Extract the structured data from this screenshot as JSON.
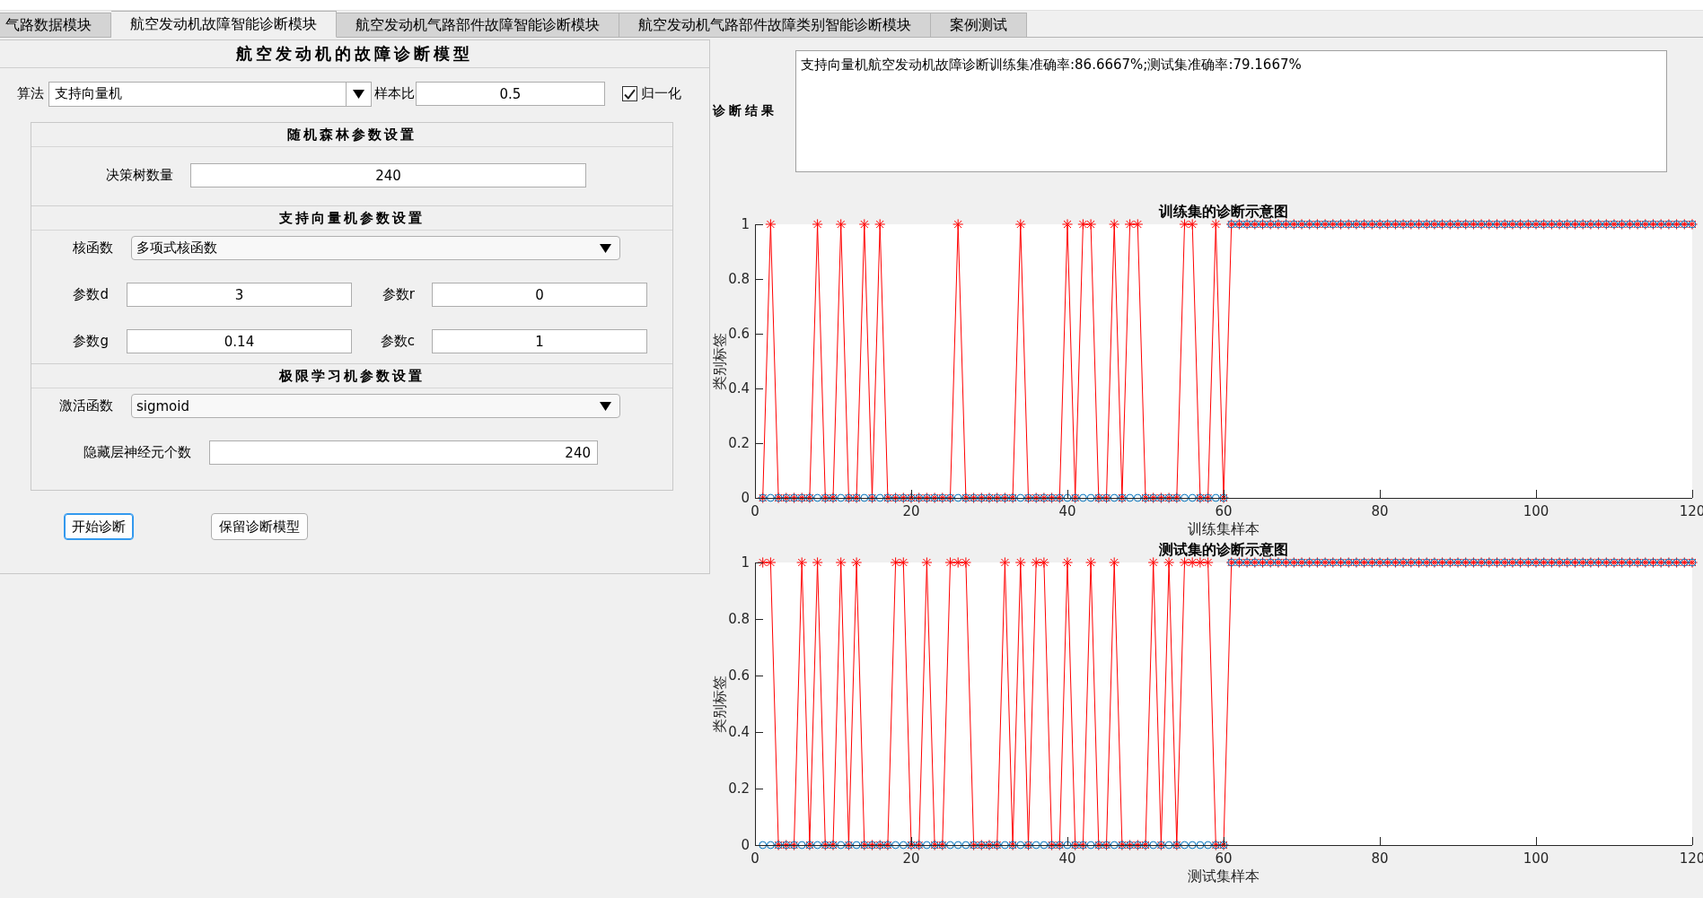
{
  "tabs": [
    {
      "label": "气路数据模块",
      "selected": false
    },
    {
      "label": "航空发动机故障智能诊断模块",
      "selected": true
    },
    {
      "label": "航空发动机气路部件故障智能诊断模块",
      "selected": false
    },
    {
      "label": "航空发动机气路部件故障类别智能诊断模块",
      "selected": false
    },
    {
      "label": "案例测试",
      "selected": false
    }
  ],
  "model_panel": {
    "title": "航空发动机的故障诊断模型",
    "algorithm": {
      "label": "算法",
      "value": "支持向量机"
    },
    "sample_ratio": {
      "label": "样本比",
      "value": "0.5"
    },
    "normalize": {
      "label": "归一化",
      "checked": true
    },
    "sections": [
      {
        "title": "随机森林参数设置",
        "rows": [
          {
            "fields": [
              {
                "kind": "input",
                "label": "决策树数量",
                "value": "240"
              }
            ]
          }
        ]
      },
      {
        "title": "支持向量机参数设置",
        "rows": [
          {
            "fields": [
              {
                "kind": "select",
                "label": "核函数",
                "value": "多项式核函数"
              }
            ]
          },
          {
            "fields": [
              {
                "kind": "input",
                "label": "参数d",
                "value": "3"
              },
              {
                "kind": "input",
                "label": "参数r",
                "value": "0"
              }
            ]
          },
          {
            "fields": [
              {
                "kind": "input",
                "label": "参数g",
                "value": "0.14"
              },
              {
                "kind": "input",
                "label": "参数c",
                "value": "1"
              }
            ]
          }
        ]
      },
      {
        "title": "极限学习机参数设置",
        "rows": [
          {
            "fields": [
              {
                "kind": "select",
                "label": "激活函数",
                "value": "sigmoid"
              }
            ]
          },
          {
            "fields": [
              {
                "kind": "input",
                "label": "隐藏层神经元个数",
                "value": "240"
              }
            ]
          }
        ]
      }
    ],
    "buttons": [
      {
        "label": "开始诊断",
        "focused": true
      },
      {
        "label": "保留诊断模型",
        "focused": false
      }
    ]
  },
  "result": {
    "label": "诊断结果",
    "text": "支持向量机航空发动机故障诊断训练集准确率:86.6667%;测试集准确率:79.1667%"
  },
  "charts": [
    {
      "chart_data": {
        "type": "line",
        "title": "训练集的诊断示意图",
        "xlabel": "训练集样本",
        "ylabel": "类别标签",
        "x": [
          1,
          2,
          3,
          4,
          5,
          6,
          7,
          8,
          9,
          10,
          11,
          12,
          13,
          14,
          15,
          16,
          17,
          18,
          19,
          20,
          21,
          22,
          23,
          24,
          25,
          26,
          27,
          28,
          29,
          30,
          31,
          32,
          33,
          34,
          35,
          36,
          37,
          38,
          39,
          40,
          41,
          42,
          43,
          44,
          45,
          46,
          47,
          48,
          49,
          50,
          51,
          52,
          53,
          54,
          55,
          56,
          57,
          58,
          59,
          60,
          61,
          62,
          63,
          64,
          65,
          66,
          67,
          68,
          69,
          70,
          71,
          72,
          73,
          74,
          75,
          76,
          77,
          78,
          79,
          80,
          81,
          82,
          83,
          84,
          85,
          86,
          87,
          88,
          89,
          90,
          91,
          92,
          93,
          94,
          95,
          96,
          97,
          98,
          99,
          100,
          101,
          102,
          103,
          104,
          105,
          106,
          107,
          108,
          109,
          110,
          111,
          112,
          113,
          114,
          115,
          116,
          117,
          118,
          119,
          120
        ],
        "series": [
          {
            "color": "#ff0000",
            "marker": "cross",
            "values": [
              0,
              1,
              0,
              0,
              0,
              0,
              0,
              1,
              0,
              0,
              1,
              0,
              0,
              1,
              0,
              1,
              0,
              0,
              0,
              0,
              0,
              0,
              0,
              0,
              0,
              1,
              0,
              0,
              0,
              0,
              0,
              0,
              0,
              1,
              0,
              0,
              0,
              0,
              0,
              1,
              0,
              1,
              1,
              0,
              0,
              1,
              0,
              1,
              1,
              0,
              0,
              0,
              0,
              0,
              1,
              1,
              0,
              0,
              1,
              0,
              1,
              1,
              1,
              1,
              1,
              1,
              1,
              1,
              1,
              1,
              1,
              1,
              1,
              1,
              1,
              1,
              1,
              1,
              1,
              1,
              1,
              1,
              1,
              1,
              1,
              1,
              1,
              1,
              1,
              1,
              1,
              1,
              1,
              1,
              1,
              1,
              1,
              1,
              1,
              1,
              1,
              1,
              1,
              1,
              1,
              1,
              1,
              1,
              1,
              1,
              1,
              1,
              1,
              1,
              1,
              1,
              1,
              1,
              1,
              1
            ]
          },
          {
            "type": "scatter",
            "color": "#0072bd",
            "marker": "circle",
            "values": [
              0,
              0,
              0,
              0,
              0,
              0,
              0,
              0,
              0,
              0,
              0,
              0,
              0,
              0,
              0,
              0,
              0,
              0,
              0,
              0,
              0,
              0,
              0,
              0,
              0,
              0,
              0,
              0,
              0,
              0,
              0,
              0,
              0,
              0,
              0,
              0,
              0,
              0,
              0,
              0,
              0,
              0,
              0,
              0,
              0,
              0,
              0,
              0,
              0,
              0,
              0,
              0,
              0,
              0,
              0,
              0,
              0,
              0,
              0,
              0,
              1,
              1,
              1,
              1,
              1,
              1,
              1,
              1,
              1,
              1,
              1,
              1,
              1,
              1,
              1,
              1,
              1,
              1,
              1,
              1,
              1,
              1,
              1,
              1,
              1,
              1,
              1,
              1,
              1,
              1,
              1,
              1,
              1,
              1,
              1,
              1,
              1,
              1,
              1,
              1,
              1,
              1,
              1,
              1,
              1,
              1,
              1,
              1,
              1,
              1,
              1,
              1,
              1,
              1,
              1,
              1,
              1,
              1,
              1,
              1
            ]
          }
        ],
        "xlim": [
          0,
          120
        ],
        "ylim": [
          0,
          1
        ],
        "xticks": [
          0,
          20,
          40,
          60,
          80,
          100,
          120
        ],
        "yticks": [
          0,
          0.2,
          0.4,
          0.6,
          0.8,
          1
        ]
      }
    },
    {
      "chart_data": {
        "type": "line",
        "title": "测试集的诊断示意图",
        "xlabel": "测试集样本",
        "ylabel": "类别标签",
        "x": [
          1,
          2,
          3,
          4,
          5,
          6,
          7,
          8,
          9,
          10,
          11,
          12,
          13,
          14,
          15,
          16,
          17,
          18,
          19,
          20,
          21,
          22,
          23,
          24,
          25,
          26,
          27,
          28,
          29,
          30,
          31,
          32,
          33,
          34,
          35,
          36,
          37,
          38,
          39,
          40,
          41,
          42,
          43,
          44,
          45,
          46,
          47,
          48,
          49,
          50,
          51,
          52,
          53,
          54,
          55,
          56,
          57,
          58,
          59,
          60,
          61,
          62,
          63,
          64,
          65,
          66,
          67,
          68,
          69,
          70,
          71,
          72,
          73,
          74,
          75,
          76,
          77,
          78,
          79,
          80,
          81,
          82,
          83,
          84,
          85,
          86,
          87,
          88,
          89,
          90,
          91,
          92,
          93,
          94,
          95,
          96,
          97,
          98,
          99,
          100,
          101,
          102,
          103,
          104,
          105,
          106,
          107,
          108,
          109,
          110,
          111,
          112,
          113,
          114,
          115,
          116,
          117,
          118,
          119,
          120
        ],
        "series": [
          {
            "color": "#ff0000",
            "marker": "cross",
            "values": [
              1,
              1,
              0,
              0,
              0,
              1,
              0,
              1,
              0,
              0,
              1,
              0,
              1,
              0,
              0,
              0,
              0,
              1,
              1,
              0,
              0,
              1,
              0,
              0,
              1,
              1,
              1,
              0,
              0,
              0,
              0,
              1,
              0,
              1,
              0,
              1,
              1,
              0,
              0,
              1,
              0,
              0,
              1,
              0,
              0,
              1,
              0,
              0,
              0,
              0,
              1,
              0,
              1,
              0,
              1,
              1,
              1,
              1,
              0,
              0,
              1,
              1,
              1,
              1,
              1,
              1,
              1,
              1,
              1,
              1,
              1,
              1,
              1,
              1,
              1,
              1,
              1,
              1,
              1,
              1,
              1,
              1,
              1,
              1,
              1,
              1,
              1,
              1,
              1,
              1,
              1,
              1,
              1,
              1,
              1,
              1,
              1,
              1,
              1,
              1,
              1,
              1,
              1,
              1,
              1,
              1,
              1,
              1,
              1,
              1,
              1,
              1,
              1,
              1,
              1,
              1,
              1,
              1,
              1,
              1
            ]
          },
          {
            "type": "scatter",
            "color": "#0072bd",
            "marker": "circle",
            "values": [
              0,
              0,
              0,
              0,
              0,
              0,
              0,
              0,
              0,
              0,
              0,
              0,
              0,
              0,
              0,
              0,
              0,
              0,
              0,
              0,
              0,
              0,
              0,
              0,
              0,
              0,
              0,
              0,
              0,
              0,
              0,
              0,
              0,
              0,
              0,
              0,
              0,
              0,
              0,
              0,
              0,
              0,
              0,
              0,
              0,
              0,
              0,
              0,
              0,
              0,
              0,
              0,
              0,
              0,
              0,
              0,
              0,
              0,
              0,
              0,
              1,
              1,
              1,
              1,
              1,
              1,
              1,
              1,
              1,
              1,
              1,
              1,
              1,
              1,
              1,
              1,
              1,
              1,
              1,
              1,
              1,
              1,
              1,
              1,
              1,
              1,
              1,
              1,
              1,
              1,
              1,
              1,
              1,
              1,
              1,
              1,
              1,
              1,
              1,
              1,
              1,
              1,
              1,
              1,
              1,
              1,
              1,
              1,
              1,
              1,
              1,
              1,
              1,
              1,
              1,
              1,
              1,
              1,
              1,
              1
            ]
          }
        ],
        "xlim": [
          0,
          120
        ],
        "ylim": [
          0,
          1
        ],
        "xticks": [
          0,
          20,
          40,
          60,
          80,
          100,
          120
        ],
        "yticks": [
          0,
          0.2,
          0.4,
          0.6,
          0.8,
          1
        ]
      }
    }
  ]
}
